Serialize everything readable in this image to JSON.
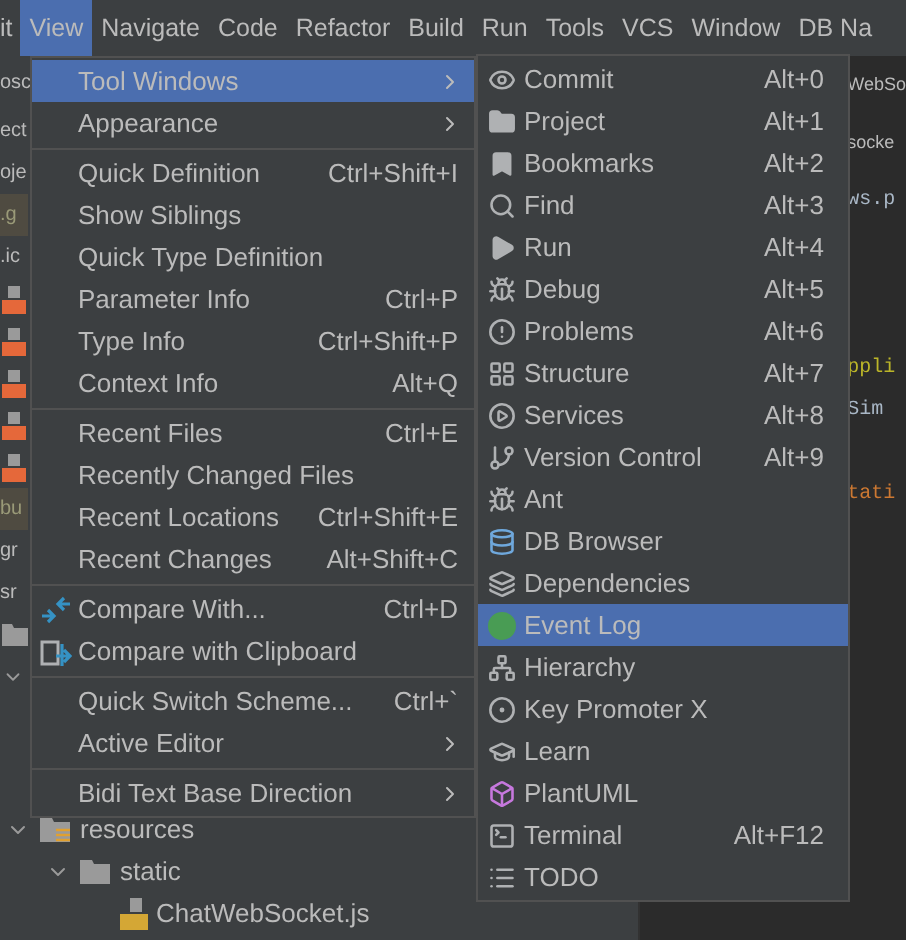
{
  "menu_bar": [
    {
      "label": "it",
      "selected": false
    },
    {
      "label": "View",
      "selected": true
    },
    {
      "label": "Navigate",
      "selected": false
    },
    {
      "label": "Code",
      "selected": false
    },
    {
      "label": "Refactor",
      "selected": false
    },
    {
      "label": "Build",
      "selected": false
    },
    {
      "label": "Run",
      "selected": false
    },
    {
      "label": "Tools",
      "selected": false
    },
    {
      "label": "VCS",
      "selected": false
    },
    {
      "label": "Window",
      "selected": false
    },
    {
      "label": "DB Na",
      "selected": false
    }
  ],
  "project_panel": {
    "header": "osc",
    "rows": [
      {
        "kind": "text",
        "label": "ect",
        "ignored": false
      },
      {
        "kind": "text",
        "label": "oje",
        "ignored": false
      },
      {
        "kind": "text",
        "label": ".g",
        "ignored": true
      },
      {
        "kind": "text",
        "label": ".ic",
        "ignored": false
      },
      {
        "kind": "file"
      },
      {
        "kind": "file"
      },
      {
        "kind": "file"
      },
      {
        "kind": "file"
      },
      {
        "kind": "file"
      },
      {
        "kind": "text",
        "label": "bu",
        "ignored": true
      },
      {
        "kind": "text",
        "label": "gr",
        "ignored": false
      },
      {
        "kind": "text",
        "label": "sr",
        "ignored": false
      },
      {
        "kind": "folder"
      },
      {
        "kind": "chevron"
      }
    ],
    "tree": [
      {
        "label": "resources",
        "expanded": true,
        "children": [
          {
            "label": "static",
            "expanded": true,
            "children": [
              {
                "label": "ChatWebSocket.js"
              }
            ]
          }
        ]
      }
    ]
  },
  "editor": {
    "tab": "WebSo",
    "breadcrumb": "socke",
    "code_lines": [
      {
        "text": "ws.p",
        "color": "#a9b7c6"
      },
      {
        "text": "ppli",
        "color": "#bbb529"
      },
      {
        "text": "Sim",
        "color": "#a9b7c6"
      },
      {
        "text": "tati",
        "color": "#cc7832"
      }
    ]
  },
  "view_menu": {
    "items": [
      {
        "kind": "item",
        "label": "Tool Windows",
        "submenu": true,
        "selected": true
      },
      {
        "kind": "item",
        "label": "Appearance",
        "submenu": true,
        "selected": false
      },
      {
        "kind": "separator"
      },
      {
        "kind": "item",
        "label": "Quick Definition",
        "shortcut": "Ctrl+Shift+I",
        "selected": false
      },
      {
        "kind": "item",
        "label": "Show Siblings",
        "selected": false
      },
      {
        "kind": "item",
        "label": "Quick Type Definition",
        "selected": false
      },
      {
        "kind": "item",
        "label": "Parameter Info",
        "shortcut": "Ctrl+P",
        "selected": false
      },
      {
        "kind": "item",
        "label": "Type Info",
        "shortcut": "Ctrl+Shift+P",
        "selected": false
      },
      {
        "kind": "item",
        "label": "Context Info",
        "shortcut": "Alt+Q",
        "selected": false
      },
      {
        "kind": "separator"
      },
      {
        "kind": "item",
        "label": "Recent Files",
        "shortcut": "Ctrl+E",
        "selected": false
      },
      {
        "kind": "item",
        "label": "Recently Changed Files",
        "selected": false
      },
      {
        "kind": "item",
        "label": "Recent Locations",
        "shortcut": "Ctrl+Shift+E",
        "selected": false
      },
      {
        "kind": "item",
        "label": "Recent Changes",
        "shortcut": "Alt+Shift+C",
        "selected": false
      },
      {
        "kind": "separator"
      },
      {
        "kind": "item",
        "label": "Compare With...",
        "shortcut": "Ctrl+D",
        "selected": false
      },
      {
        "kind": "item",
        "label": "Compare with Clipboard",
        "selected": false
      },
      {
        "kind": "separator"
      },
      {
        "kind": "item",
        "label": "Quick Switch Scheme...",
        "shortcut": "Ctrl+`",
        "selected": false
      },
      {
        "kind": "item",
        "label": "Active Editor",
        "submenu": true,
        "selected": false
      },
      {
        "kind": "separator"
      },
      {
        "kind": "item",
        "label": "Bidi Text Base Direction",
        "submenu": true,
        "selected": false
      }
    ]
  },
  "tool_windows_menu": {
    "items": [
      {
        "label": "Commit",
        "shortcut": "Alt+0",
        "selected": false
      },
      {
        "label": "Project",
        "shortcut": "Alt+1",
        "selected": false
      },
      {
        "label": "Bookmarks",
        "shortcut": "Alt+2",
        "selected": false
      },
      {
        "label": "Find",
        "shortcut": "Alt+3",
        "selected": false
      },
      {
        "label": "Run",
        "shortcut": "Alt+4",
        "selected": false
      },
      {
        "label": "Debug",
        "shortcut": "Alt+5",
        "selected": false
      },
      {
        "label": "Problems",
        "shortcut": "Alt+6",
        "selected": false
      },
      {
        "label": "Structure",
        "shortcut": "Alt+7",
        "selected": false
      },
      {
        "label": "Services",
        "shortcut": "Alt+8",
        "selected": false
      },
      {
        "label": "Version Control",
        "shortcut": "Alt+9",
        "selected": false
      },
      {
        "label": "Ant",
        "selected": false
      },
      {
        "label": "DB Browser",
        "selected": false
      },
      {
        "label": "Dependencies",
        "selected": false
      },
      {
        "label": "Event Log",
        "selected": true
      },
      {
        "label": "Hierarchy",
        "selected": false
      },
      {
        "label": "Key Promoter X",
        "selected": false
      },
      {
        "label": "Learn",
        "selected": false
      },
      {
        "label": "PlantUML",
        "selected": false
      },
      {
        "label": "Terminal",
        "shortcut": "Alt+F12",
        "selected": false
      },
      {
        "label": "TODO",
        "selected": false
      }
    ]
  }
}
